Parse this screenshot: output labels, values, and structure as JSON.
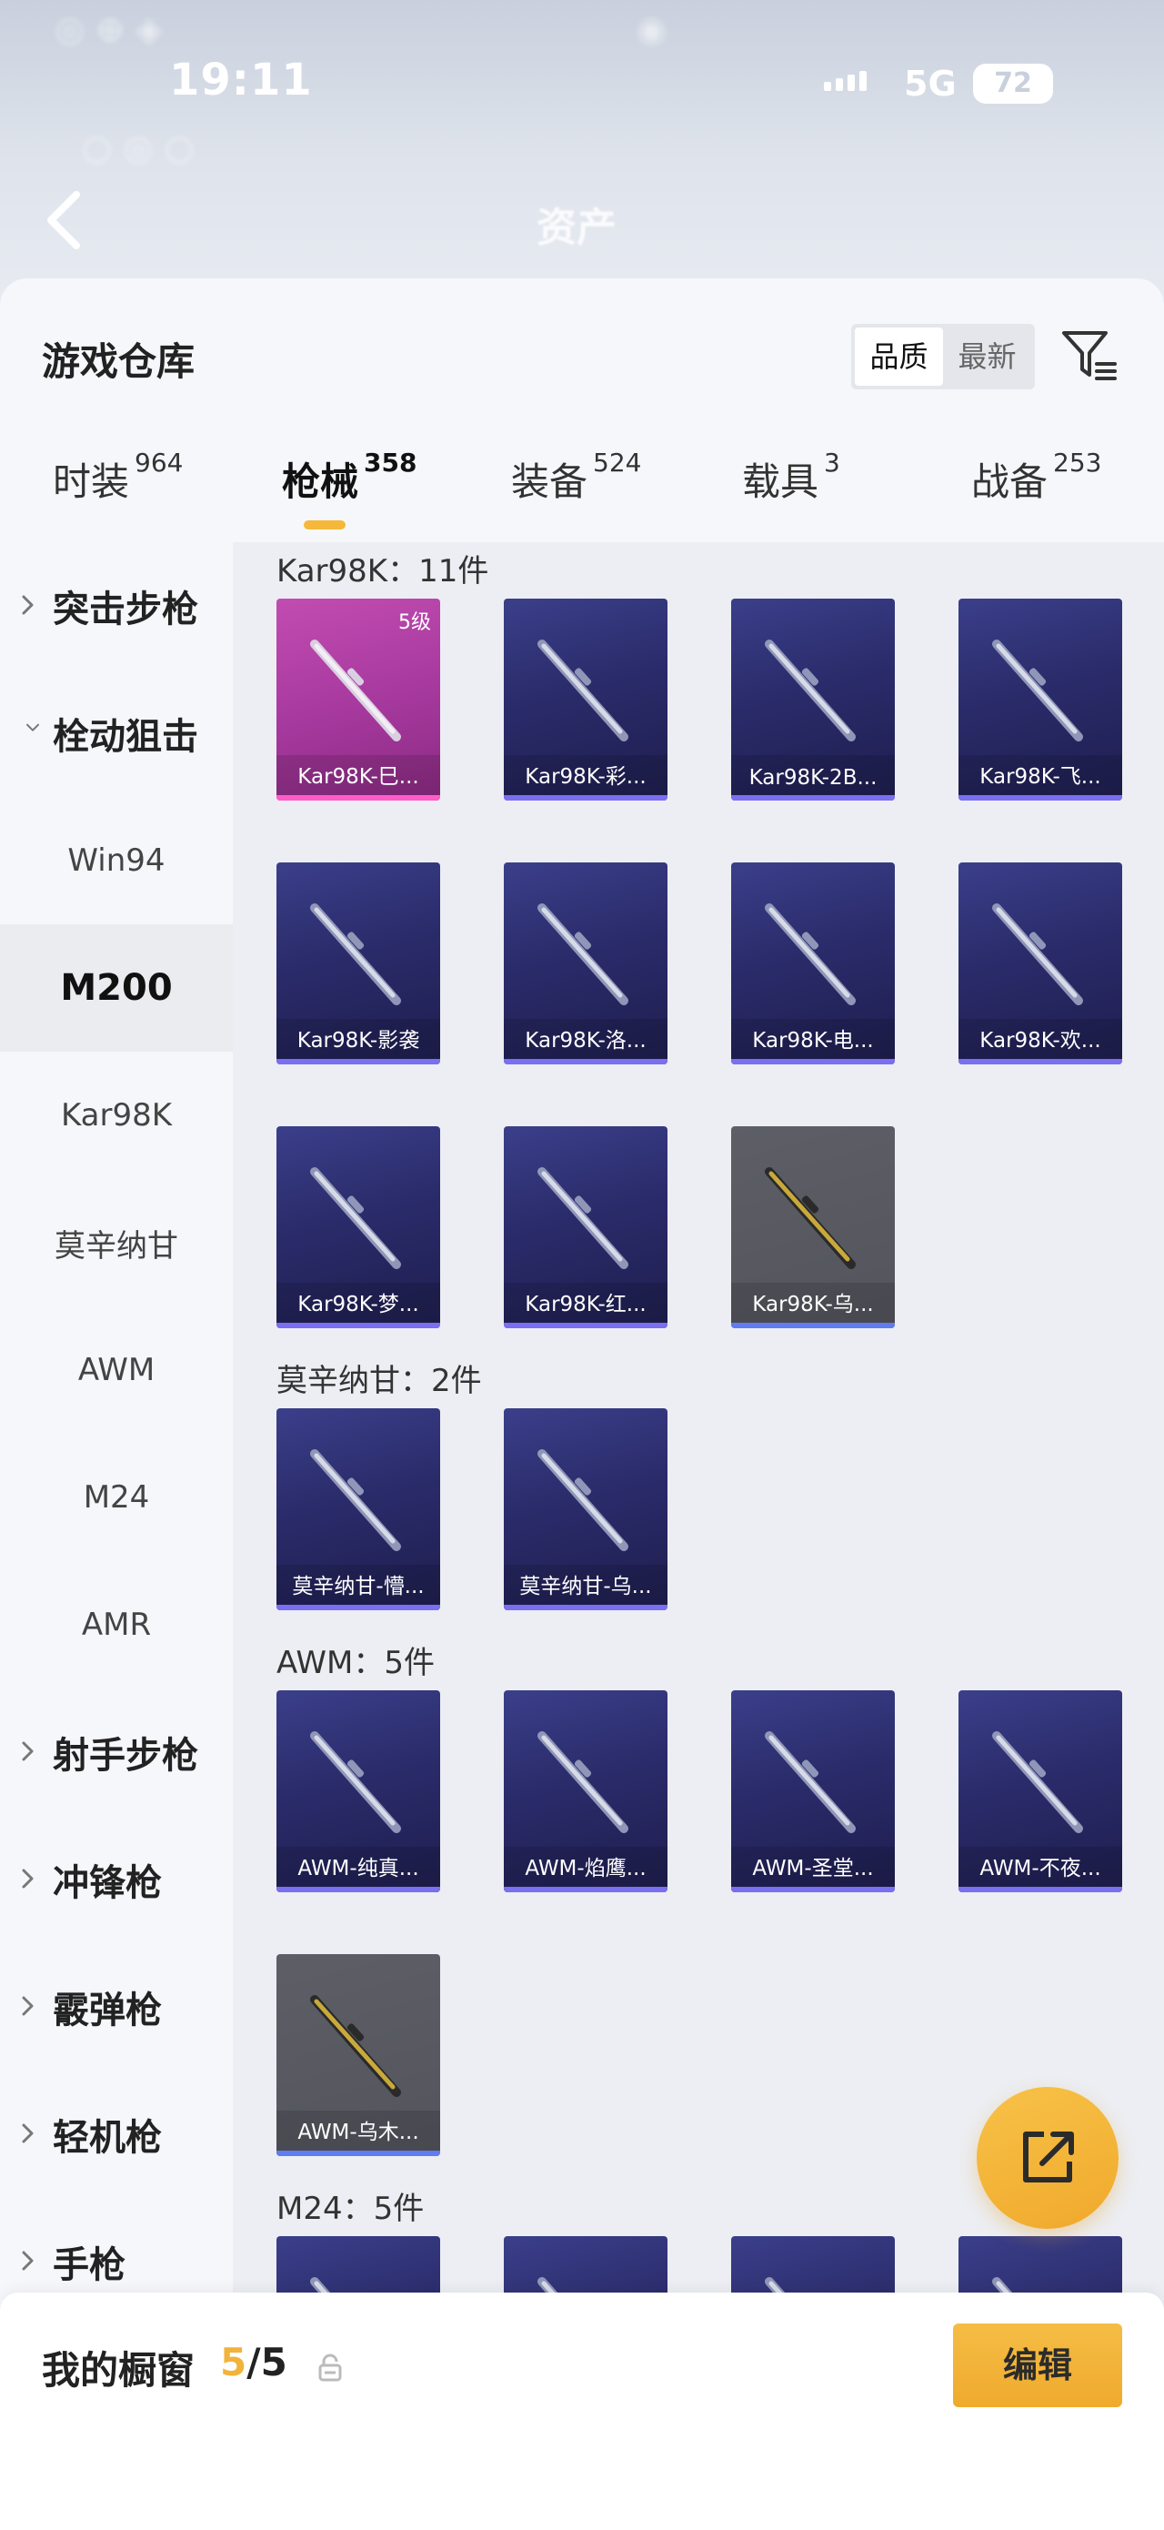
{
  "status_bar": {
    "time": "19:11",
    "network": "5G",
    "battery": "72"
  },
  "background_page": {
    "title": "资产"
  },
  "warehouse": {
    "title": "游戏仓库",
    "sort_options": [
      "品质",
      "最新"
    ],
    "active_sort": "品质"
  },
  "tabs": [
    {
      "label": "时装",
      "count": "964"
    },
    {
      "label": "枪械",
      "count": "358"
    },
    {
      "label": "装备",
      "count": "524"
    },
    {
      "label": "载具",
      "count": "3"
    },
    {
      "label": "战备",
      "count": "253"
    }
  ],
  "active_tab": "枪械",
  "sidebar": {
    "items": [
      {
        "label": "突击步枪",
        "type": "category",
        "expanded": false
      },
      {
        "label": "栓动狙击",
        "type": "category",
        "expanded": true
      },
      {
        "label": "Win94",
        "type": "sub"
      },
      {
        "label": "M200",
        "type": "sub",
        "selected": true
      },
      {
        "label": "Kar98K",
        "type": "sub"
      },
      {
        "label": "莫辛纳甘",
        "type": "sub"
      },
      {
        "label": "AWM",
        "type": "sub"
      },
      {
        "label": "M24",
        "type": "sub"
      },
      {
        "label": "AMR",
        "type": "sub"
      },
      {
        "label": "射手步枪",
        "type": "category",
        "expanded": false
      },
      {
        "label": "冲锋枪",
        "type": "category",
        "expanded": false
      },
      {
        "label": "霰弹枪",
        "type": "category",
        "expanded": false
      },
      {
        "label": "轻机枪",
        "type": "category",
        "expanded": false
      },
      {
        "label": "手枪",
        "type": "category",
        "expanded": false
      }
    ]
  },
  "sections": [
    {
      "label": "Kar98K：11件",
      "items": [
        {
          "name": "Kar98K-巳...",
          "level": "5级",
          "rarity": "pink"
        },
        {
          "name": "Kar98K-彩...",
          "rarity": "purple"
        },
        {
          "name": "Kar98K-2B...",
          "rarity": "purple"
        },
        {
          "name": "Kar98K-飞...",
          "rarity": "purple"
        },
        {
          "name": "Kar98K-影袭",
          "rarity": "purple"
        },
        {
          "name": "Kar98K-洛...",
          "rarity": "purple"
        },
        {
          "name": "Kar98K-电...",
          "rarity": "purple"
        },
        {
          "name": "Kar98K-欢...",
          "rarity": "purple"
        },
        {
          "name": "Kar98K-梦...",
          "rarity": "purple"
        },
        {
          "name": "Kar98K-红...",
          "rarity": "purple"
        },
        {
          "name": "Kar98K-乌...",
          "rarity": "grey"
        }
      ]
    },
    {
      "label": "莫辛纳甘：2件",
      "items": [
        {
          "name": "莫辛纳甘-懵...",
          "rarity": "purple"
        },
        {
          "name": "莫辛纳甘-乌...",
          "rarity": "purple"
        }
      ]
    },
    {
      "label": "AWM：5件",
      "items": [
        {
          "name": "AWM-纯真...",
          "rarity": "purple"
        },
        {
          "name": "AWM-焰鹰...",
          "rarity": "purple"
        },
        {
          "name": "AWM-圣堂...",
          "rarity": "purple"
        },
        {
          "name": "AWM-不夜...",
          "rarity": "purple"
        },
        {
          "name": "AWM-乌木...",
          "rarity": "grey"
        }
      ]
    },
    {
      "label": "M24：5件",
      "items": []
    }
  ],
  "showcase": {
    "title": "我的橱窗",
    "current": "5",
    "total": "/5",
    "edit_label": "编辑"
  },
  "colors": {
    "accent": "#f2b33a",
    "rarity_purple": "#7a6ff0",
    "rarity_pink": "#ff5cc8"
  }
}
